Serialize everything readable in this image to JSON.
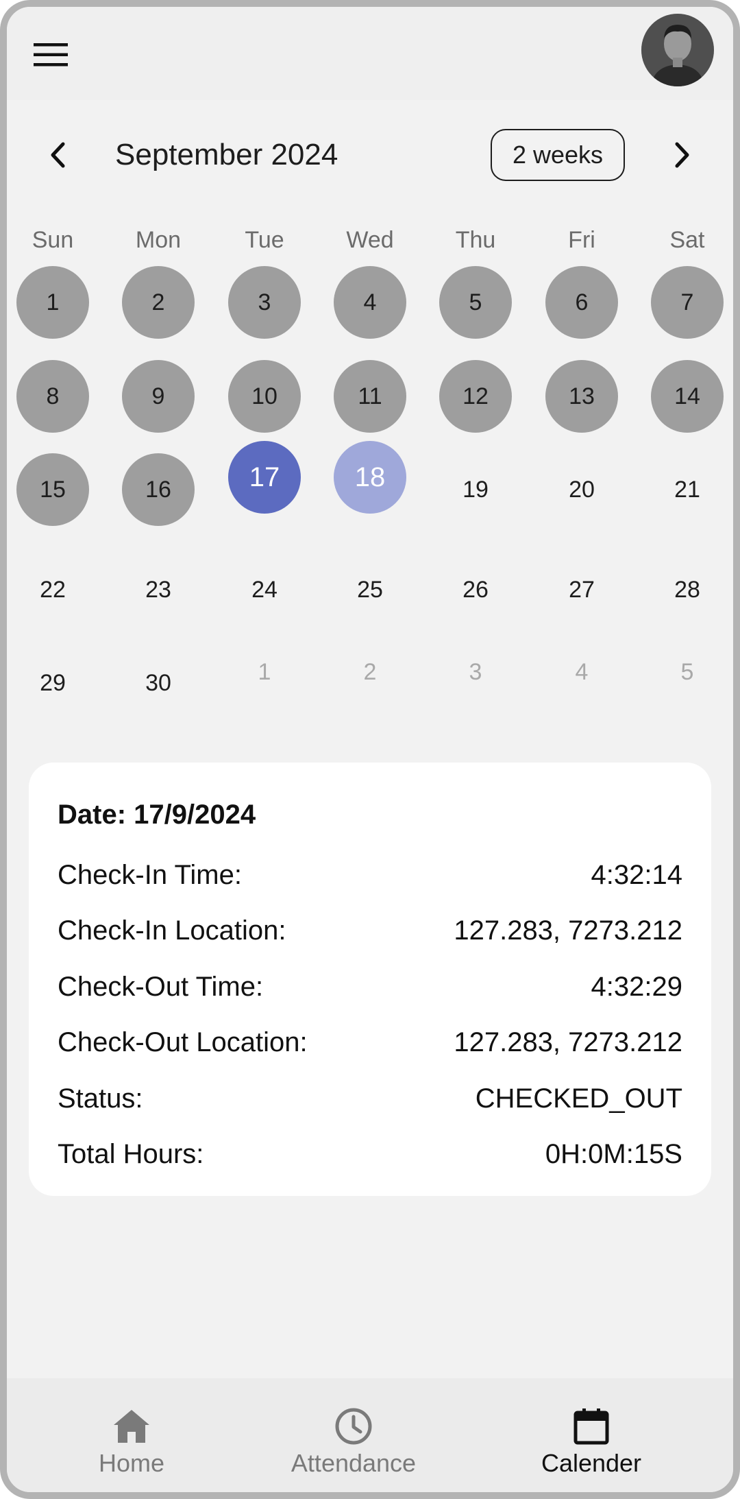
{
  "header": {
    "menu_icon": "hamburger-menu-icon",
    "avatar_icon": "user-avatar"
  },
  "calendar": {
    "month_title": "September 2024",
    "format_button": "2 weeks",
    "prev_icon": "chevron-left-icon",
    "next_icon": "chevron-right-icon",
    "weekdays": [
      "Sun",
      "Mon",
      "Tue",
      "Wed",
      "Thu",
      "Fri",
      "Sat"
    ],
    "selected_color": "#5c6bc0",
    "today_color": "#9fa8da",
    "past_color": "#9e9e9e",
    "weeks": [
      [
        "1",
        "2",
        "3",
        "4",
        "5",
        "6",
        "7"
      ],
      [
        "8",
        "9",
        "10",
        "11",
        "12",
        "13",
        "14"
      ],
      [
        "15",
        "16",
        "17",
        "18",
        "19",
        "20",
        "21"
      ],
      [
        "22",
        "23",
        "24",
        "25",
        "26",
        "27",
        "28"
      ],
      [
        "29",
        "30",
        "1",
        "2",
        "3",
        "4",
        "5"
      ]
    ]
  },
  "details": {
    "date_line": "Date: 17/9/2024",
    "rows": [
      {
        "label": "Check-In Time:",
        "value": "4:32:14"
      },
      {
        "label": "Check-In Location:",
        "value": "127.283, 7273.212"
      },
      {
        "label": "Check-Out Time:",
        "value": "4:32:29"
      },
      {
        "label": "Check-Out Location:",
        "value": "127.283, 7273.212"
      },
      {
        "label": "Status:",
        "value": "CHECKED_OUT"
      },
      {
        "label": "Total Hours:",
        "value": "0H:0M:15S"
      }
    ]
  },
  "bottom_nav": {
    "items": [
      {
        "label": "Home",
        "icon": "home-icon"
      },
      {
        "label": "Attendance",
        "icon": "clock-icon"
      },
      {
        "label": "Calender",
        "icon": "calendar-icon",
        "active": true
      }
    ]
  }
}
